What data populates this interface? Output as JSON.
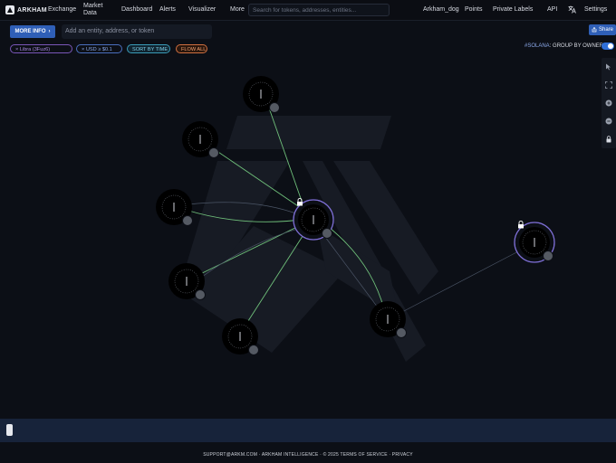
{
  "brand": {
    "name": "ARKHAM"
  },
  "nav": {
    "exchange": "Exchange",
    "market_data_line1": "Market",
    "market_data_line2": "Data",
    "dashboard": "Dashboard",
    "alerts": "Alerts",
    "visualizer": "Visualizer",
    "more": "More"
  },
  "search": {
    "placeholder": "Search for tokens, addresses, entities..."
  },
  "right_nav": {
    "user": "Arkham_dog",
    "points": "Points",
    "private_labels": "Private Labels",
    "api": "API",
    "translate_icon": "translate-icon",
    "settings": "Settings"
  },
  "toolbar": {
    "more_info": "MORE INFO",
    "chevron": "›",
    "entity_placeholder": "Add an entity, address, or token",
    "share": "Share"
  },
  "filters": [
    {
      "label": "Libra (3Fuz6)",
      "color": "#a888e0"
    },
    {
      "label": "USD ≥ $0.1",
      "color": "#8aa8e8"
    },
    {
      "label": "SORT BY TIME",
      "color": "#7fd0e8"
    },
    {
      "label": "FLOW ALL",
      "color": "#f0a070"
    }
  ],
  "filter_remove_glyph": "×",
  "group": {
    "chain_prefix": "#",
    "chain": "SOLANA",
    "label": ": GROUP BY OWNER"
  },
  "footer": {
    "text": "SUPPORT@ARKM.COM · ARKHAM INTELLIGENCE · © 2025   TERMS OF SERVICE · PRIVACY"
  },
  "colors": {
    "accent": "#2f5fb7",
    "edge_green": "#6fbf7a",
    "center_ring": "#7e6fd6"
  },
  "graph": {
    "nodes": [
      {
        "id": "n1",
        "ring": false,
        "locked": false
      },
      {
        "id": "n2",
        "ring": false,
        "locked": false
      },
      {
        "id": "n3",
        "ring": false,
        "locked": false
      },
      {
        "id": "center",
        "ring": true,
        "locked": true
      },
      {
        "id": "n5",
        "ring": false,
        "locked": false
      },
      {
        "id": "n6",
        "ring": false,
        "locked": false
      },
      {
        "id": "n7",
        "ring": false,
        "locked": false
      },
      {
        "id": "right",
        "ring": true,
        "locked": true
      }
    ]
  }
}
